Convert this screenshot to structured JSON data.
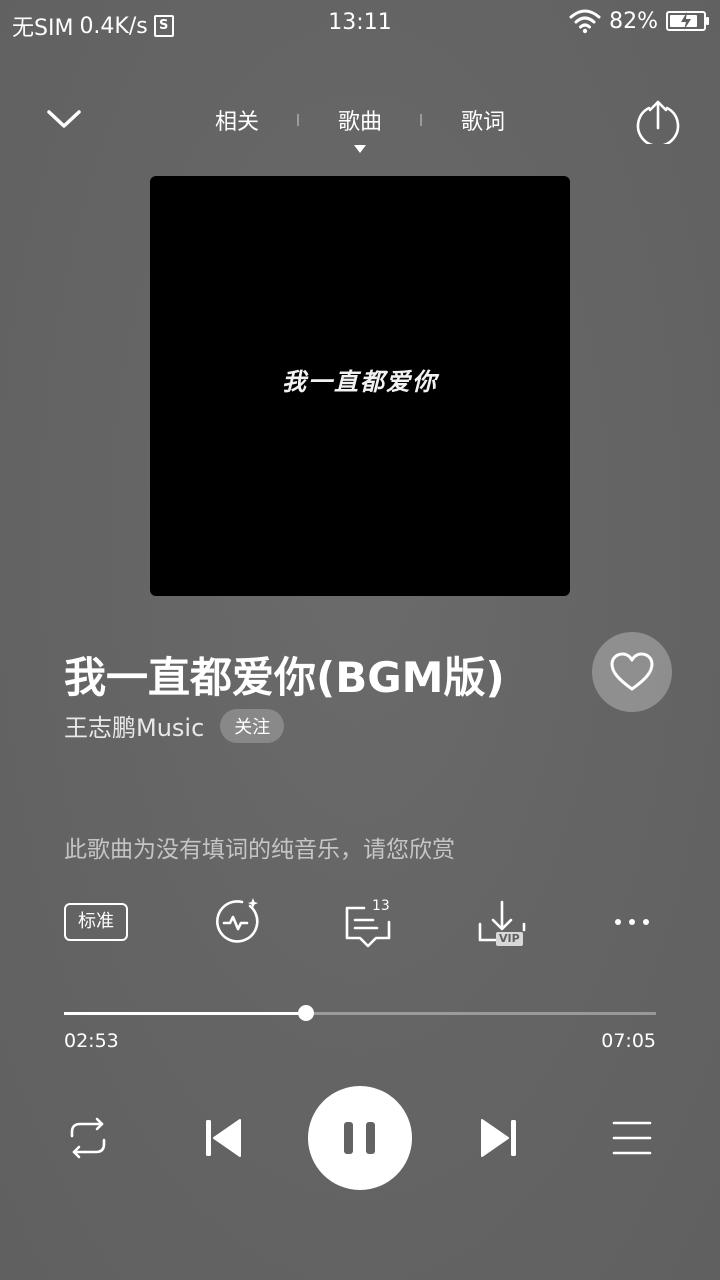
{
  "status_bar": {
    "carrier": "无SIM",
    "net_speed": "0.4K/s",
    "app_badge": "S",
    "time": "13:11",
    "battery": "82%",
    "battery_level": 0.82
  },
  "nav": {
    "tabs": [
      {
        "label": "相关"
      },
      {
        "label": "歌曲",
        "active": true
      },
      {
        "label": "歌词"
      }
    ],
    "icons": {
      "collapse": "chevron-down-icon",
      "share": "share-upload-icon"
    }
  },
  "album": {
    "cover_text": "我一直都爱你"
  },
  "song": {
    "title": "我一直都爱你(BGM版)",
    "artist": "王志鹏Music",
    "follow_label": "关注",
    "liked": false
  },
  "lyrics_note": "此歌曲为没有填词的纯音乐，请您欣赏",
  "actions": {
    "quality_label": "标准",
    "comment_count": "13",
    "vip_label": "VIP",
    "icons": [
      "sound-effect-icon",
      "comment-icon",
      "download-icon",
      "more-icon"
    ]
  },
  "progress": {
    "elapsed": "02:53",
    "total": "07:05",
    "fraction": 0.408
  },
  "controls": {
    "state": "playing",
    "icons": [
      "repeat-icon",
      "previous-icon",
      "pause-icon",
      "next-icon",
      "playlist-icon"
    ]
  },
  "colors": {
    "background": "#656565",
    "foreground": "#ffffff",
    "cover": "#000000"
  }
}
